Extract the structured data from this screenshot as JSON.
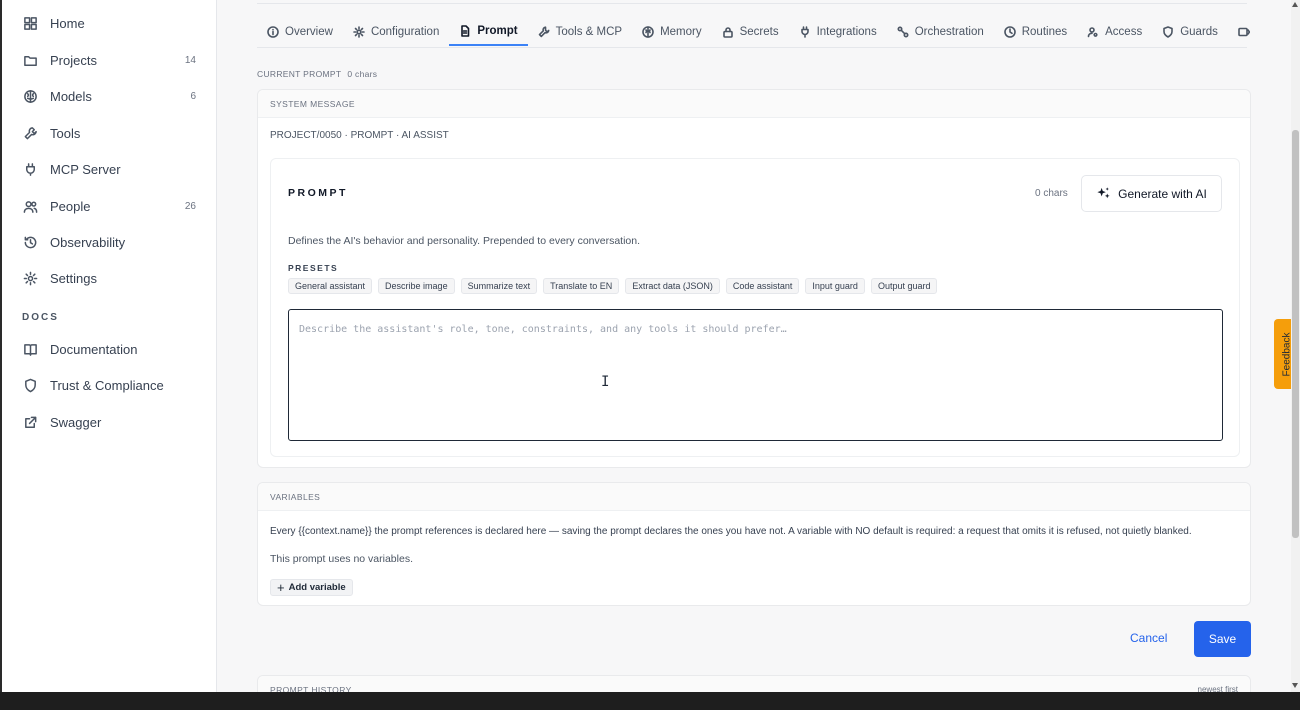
{
  "sidebar": {
    "items": [
      {
        "label": "Home",
        "icon": "grid-icon"
      },
      {
        "label": "Projects",
        "count": "14",
        "icon": "folder-icon"
      },
      {
        "label": "Models",
        "count": "6",
        "icon": "brain-icon"
      },
      {
        "label": "Tools",
        "icon": "wrench-icon"
      },
      {
        "label": "MCP Server",
        "icon": "plug-icon"
      },
      {
        "label": "People",
        "count": "26",
        "icon": "people-icon"
      },
      {
        "label": "Observability",
        "icon": "history-icon"
      },
      {
        "label": "Settings",
        "icon": "gear-icon"
      }
    ],
    "docs_heading": "DOCS",
    "docs_items": [
      {
        "label": "Documentation",
        "icon": "book-icon"
      },
      {
        "label": "Trust & Compliance",
        "icon": "shield-icon"
      },
      {
        "label": "Swagger",
        "icon": "external-link-icon"
      }
    ]
  },
  "tabs": [
    {
      "label": "Overview",
      "icon": "info-icon"
    },
    {
      "label": "Configuration",
      "icon": "gear-icon"
    },
    {
      "label": "Prompt",
      "icon": "document-icon",
      "active": true
    },
    {
      "label": "Tools & MCP",
      "icon": "wrench-icon"
    },
    {
      "label": "Memory",
      "icon": "brain-icon"
    },
    {
      "label": "Secrets",
      "icon": "lock-icon"
    },
    {
      "label": "Integrations",
      "icon": "plug-icon"
    },
    {
      "label": "Orchestration",
      "icon": "nodes-icon"
    },
    {
      "label": "Routines",
      "icon": "clock-icon"
    },
    {
      "label": "Access",
      "icon": "user-key-icon"
    },
    {
      "label": "Guards",
      "icon": "shield-icon"
    }
  ],
  "current_prompt": {
    "label": "CURRENT PROMPT",
    "chars": "0 chars"
  },
  "system_message": {
    "heading": "SYSTEM MESSAGE",
    "breadcrumb": "PROJECT/0050 · PROMPT · AI ASSIST",
    "prompt_label": "PROMPT",
    "chars": "0 chars",
    "generate_button": "Generate with AI",
    "description": "Defines the AI's behavior and personality. Prepended to every conversation.",
    "presets_label": "PRESETS",
    "presets": [
      "General assistant",
      "Describe image",
      "Summarize text",
      "Translate to EN",
      "Extract data (JSON)",
      "Code assistant",
      "Input guard",
      "Output guard"
    ],
    "textarea_placeholder": "Describe the assistant's role, tone, constraints, and any tools it should prefer…",
    "textarea_value": ""
  },
  "variables": {
    "heading": "VARIABLES",
    "description": "Every {{context.name}} the prompt references is declared here — saving the prompt declares the ones you have not. A variable with NO default is required: a request that omits it is refused, not quietly blanked.",
    "empty_text": "This prompt uses no variables.",
    "add_button": "Add variable"
  },
  "actions": {
    "cancel": "Cancel",
    "save": "Save"
  },
  "history": {
    "heading": "PROMPT HISTORY",
    "sort": "newest first"
  },
  "feedback": "Feedback",
  "colors": {
    "accent": "#2563eb",
    "feedback": "#f59e0b",
    "tab_underline": "#3b82f6"
  }
}
